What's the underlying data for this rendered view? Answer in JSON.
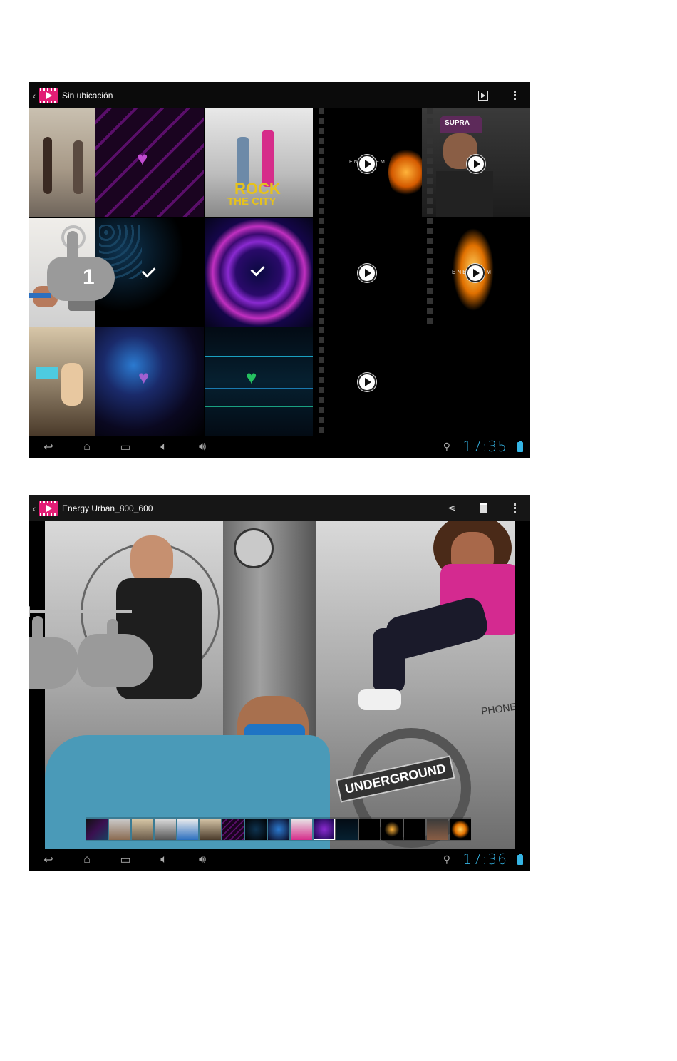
{
  "screen1": {
    "title": "Sin ubicación",
    "tiles": [
      {
        "label": ""
      },
      {
        "label": ""
      },
      {
        "label": "ROCK THE CITY"
      },
      {
        "label": "ENERGY SISTEM"
      },
      {
        "label": "SUPRA"
      },
      {
        "label": "1"
      },
      {
        "label": ""
      },
      {
        "label": ""
      },
      {
        "label": ""
      },
      {
        "label": "ENERGY SISTEM"
      },
      {
        "label": ""
      },
      {
        "label": ""
      },
      {
        "label": ""
      },
      {
        "label": ""
      }
    ],
    "rock_line1": "ROCK",
    "rock_line2": "THE CITY",
    "energy_text": "ENE   STEM",
    "energy_text2": "ENE     STEM",
    "supra": "SUPRA",
    "tap_number": "1",
    "clock": "17:35"
  },
  "screen2": {
    "title": "Energy Urban_800_600",
    "underground": "UNDERGROUND",
    "phone": "PHONE",
    "clock": "17:36"
  },
  "colors": {
    "accent": "#e21d75",
    "clock": "#35b5e5"
  },
  "icons": {
    "back": "chevron-left-icon",
    "app": "gallery-app-icon",
    "slideshow": "slideshow-icon",
    "overflow": "overflow-menu-icon",
    "share": "share-icon",
    "delete": "trash-icon"
  }
}
